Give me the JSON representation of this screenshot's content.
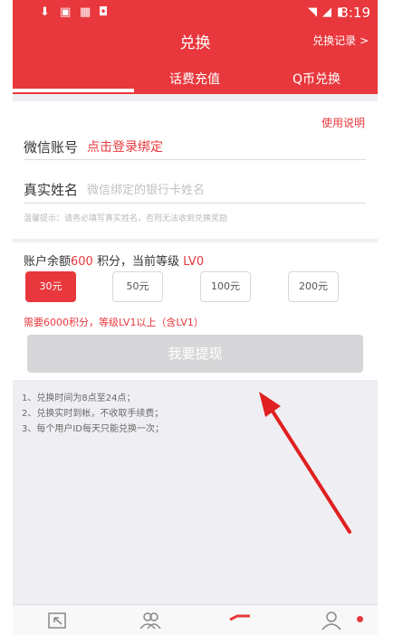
{
  "status_bar": {
    "time": "3:19"
  },
  "header": {
    "title": "兑换",
    "records_link": "兑换记录 >"
  },
  "tabs": [
    {
      "label": "话费充值"
    },
    {
      "label": "Q币兑换"
    }
  ],
  "form": {
    "help_link": "使用说明",
    "wechat_label": "微信账号",
    "wechat_action": "点击登录绑定",
    "realname_label": "真实姓名",
    "realname_placeholder": "微信绑定的银行卡姓名",
    "tip": "温馨提示：请务必填写真实姓名，否则无法收到兑换奖励"
  },
  "balance": {
    "prefix": "账户余额",
    "amount": "600",
    "middle": " 积分，当前等级 ",
    "level": "LV0"
  },
  "amounts": [
    {
      "label": "30元",
      "selected": true
    },
    {
      "label": "50元",
      "selected": false
    },
    {
      "label": "100元",
      "selected": false
    },
    {
      "label": "200元",
      "selected": false
    }
  ],
  "requirement": "需要6000积分，等级LV1以上（含LV1）",
  "withdraw_button": "我要提现",
  "rules": [
    "1、兑换时间为8点至24点；",
    "2、兑换实时到帐，不收取手续费；",
    "3、每个用户ID每天只能兑换一次；"
  ],
  "colors": {
    "accent": "#e8383d",
    "disabled_button": "#d7d7d9"
  }
}
